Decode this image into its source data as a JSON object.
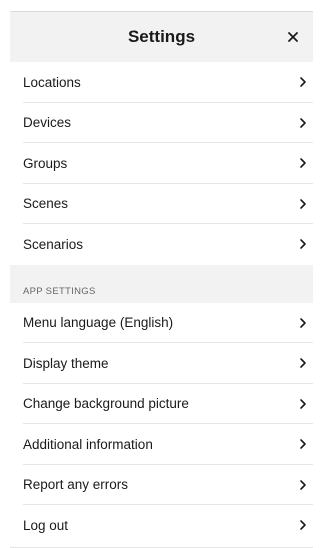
{
  "header": {
    "title": "Settings",
    "close_icon": "close-icon"
  },
  "general_items": [
    {
      "label": "Locations",
      "icon": "chevron-right-icon"
    },
    {
      "label": "Devices",
      "icon": "chevron-right-icon"
    },
    {
      "label": "Groups",
      "icon": "chevron-right-icon"
    },
    {
      "label": "Scenes",
      "icon": "chevron-right-icon"
    },
    {
      "label": "Scenarios",
      "icon": "chevron-right-icon"
    }
  ],
  "app_settings": {
    "section_title": "APP SETTINGS",
    "items": [
      {
        "label": "Menu language (English)",
        "icon": "chevron-right-icon"
      },
      {
        "label": "Display theme",
        "icon": "chevron-right-icon"
      },
      {
        "label": "Change background picture",
        "icon": "chevron-right-icon"
      },
      {
        "label": "Additional information",
        "icon": "chevron-right-icon"
      },
      {
        "label": "Report any errors",
        "icon": "chevron-right-icon"
      },
      {
        "label": "Log out",
        "icon": "chevron-right-icon"
      }
    ]
  },
  "colors": {
    "background": "#ffffff",
    "header_background": "#f2f2f2",
    "section_background": "#f2f2f2",
    "text": "#1a1a1a",
    "section_text": "#666666",
    "divider": "#e6e6e6"
  }
}
